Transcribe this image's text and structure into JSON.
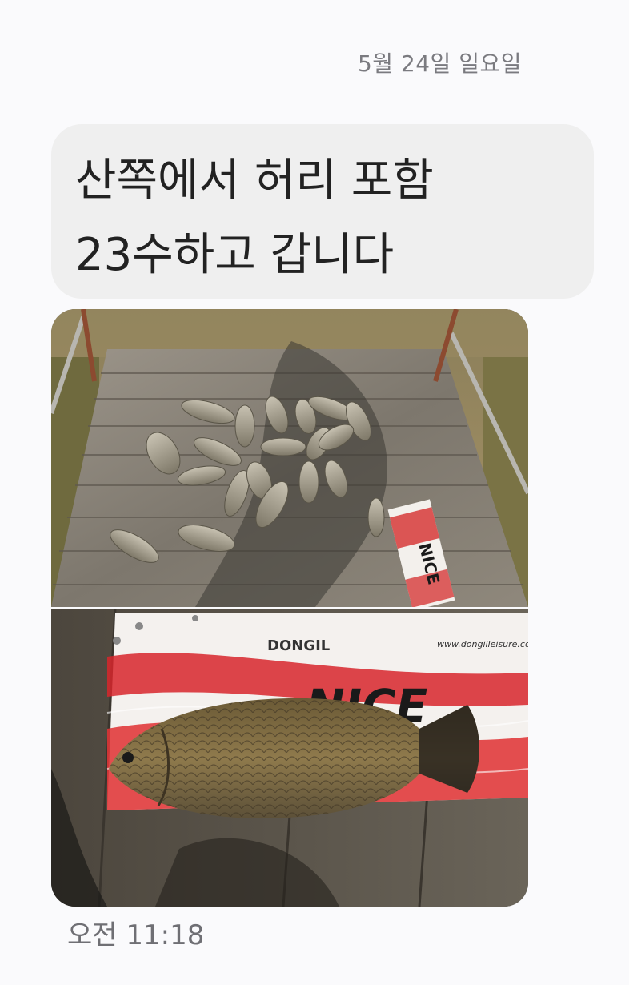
{
  "conversation": {
    "date_header": "5월 24일 일요일",
    "message": {
      "text": "산쪽에서 허리 포함\n23수하고 갑니다",
      "time": "오전 11:18"
    },
    "photos": {
      "catch_overview": {
        "ruler_brand": "NICE"
      },
      "catch_closeup": {
        "ruler_logo": "DONGIL",
        "ruler_brand": "NICE",
        "ruler_url": "www.dongilleisure.com"
      }
    }
  },
  "colors": {
    "background": "#fafafc",
    "bubble": "#efefef",
    "message_text": "#222222",
    "meta_text": "#7a7a7f"
  }
}
